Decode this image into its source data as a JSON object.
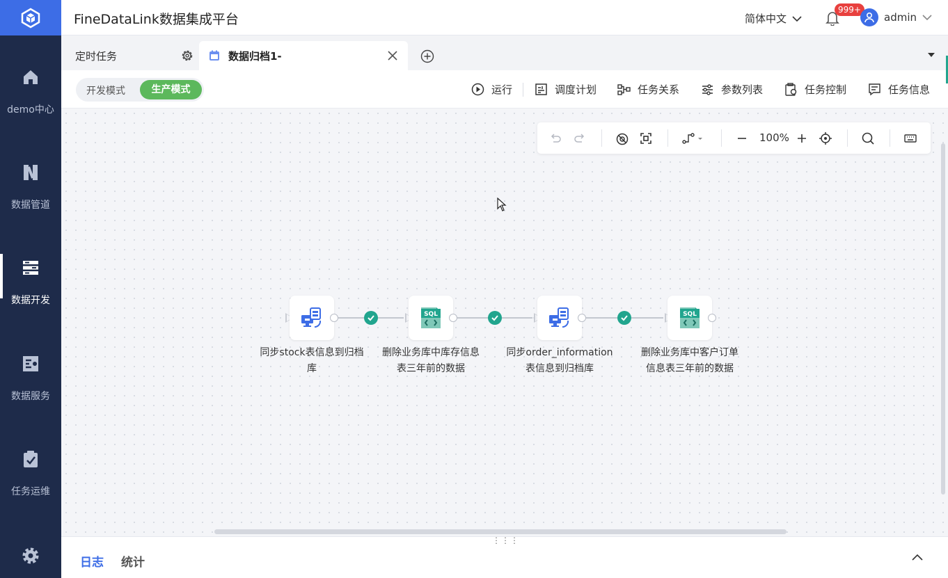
{
  "app": {
    "title": "FineDataLink数据集成平台"
  },
  "header": {
    "language": "简体中文",
    "notification_count": "999+",
    "username": "admin"
  },
  "sidebar": {
    "items": [
      {
        "label": "demo中心",
        "icon": "home-icon"
      },
      {
        "label": "数据管道",
        "icon": "pipeline-icon"
      },
      {
        "label": "数据开发",
        "icon": "data-dev-icon",
        "active": true
      },
      {
        "label": "数据服务",
        "icon": "data-service-icon"
      },
      {
        "label": "任务运维",
        "icon": "task-ops-icon"
      }
    ]
  },
  "tabs": [
    {
      "label": "定时任务"
    },
    {
      "label": "数据归档1-"
    }
  ],
  "modes": {
    "dev": "开发模式",
    "prod": "生产模式",
    "selected": "prod"
  },
  "toolbar": {
    "run": "运行",
    "schedule": "调度计划",
    "relations": "任务关系",
    "params": "参数列表",
    "control": "任务控制",
    "info": "任务信息"
  },
  "canvas": {
    "zoom": "100%"
  },
  "nodes": [
    {
      "label_line1": "同步stock表信息到归档",
      "label_line2": "库",
      "type": "sync"
    },
    {
      "label_line1": "删除业务库中库存信息",
      "label_line2": "表三年前的数据",
      "type": "sql"
    },
    {
      "label_line1": "同步order_information",
      "label_line2": "表信息到归档库",
      "type": "sync"
    },
    {
      "label_line1": "删除业务库中客户订单",
      "label_line2": "信息表三年前的数据",
      "type": "sql"
    }
  ],
  "sql_badge": "SQL",
  "bottom_panel": {
    "log_tab": "日志",
    "stats_tab": "统计",
    "handle": "⋮⋮⋮"
  },
  "colors": {
    "brand_blue": "#3d6de6",
    "sidebar": "#1e2b4a",
    "success_green": "#21a58e",
    "prod_green": "#5cb85c",
    "badge_red": "#e8403e"
  }
}
